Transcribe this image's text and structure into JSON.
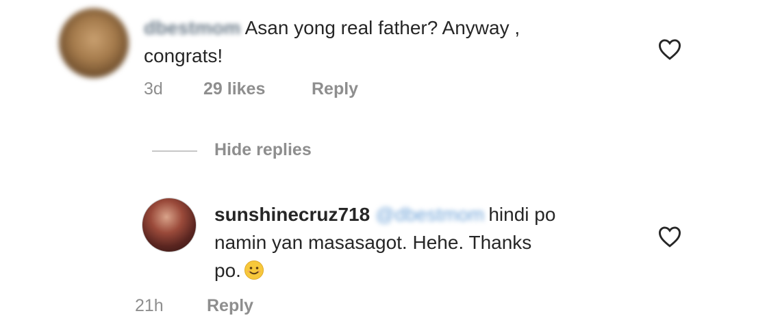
{
  "comment1": {
    "username": "dbestmom",
    "text_line1": "Asan yong real father? Anyway ,",
    "text_line2": "congrats!",
    "time": "3d",
    "likes": "29 likes",
    "reply_label": "Reply"
  },
  "hide_replies_label": "Hide replies",
  "comment2": {
    "username": "sunshinecruz718",
    "mention": "@dbestmom",
    "text_line1_rest": "hindi po",
    "text_line2": "namin yan masasagot. Hehe. Thanks",
    "text_line3": "po.",
    "time": "21h",
    "reply_label": "Reply"
  },
  "icons": {
    "heart": "heart-outline-icon",
    "emoji": "smiling-face-emoji"
  },
  "colors": {
    "text": "#262626",
    "meta": "#8e8e8e",
    "mention": "#6fa3d8"
  }
}
